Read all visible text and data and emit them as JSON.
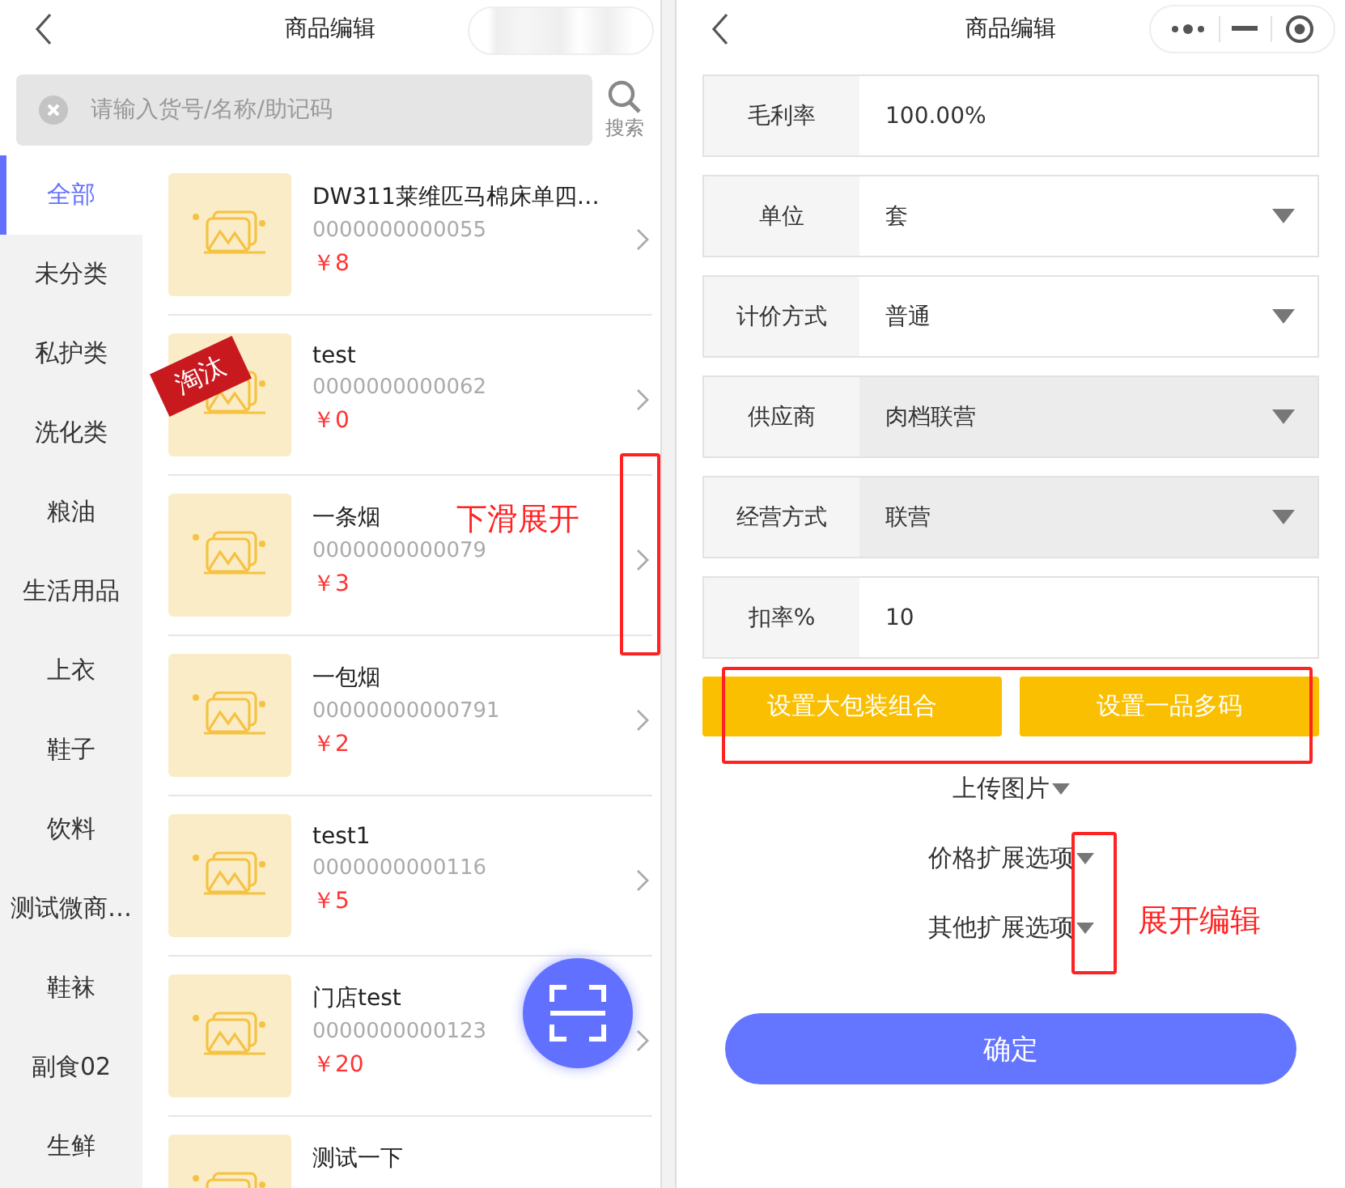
{
  "left": {
    "title": "商品编辑",
    "search": {
      "placeholder": "请输入货号/名称/助记码",
      "button": "搜索"
    },
    "categories": [
      {
        "label": "全部",
        "selected": true
      },
      {
        "label": "未分类",
        "selected": false
      },
      {
        "label": "私护类",
        "selected": false
      },
      {
        "label": "洗化类",
        "selected": false
      },
      {
        "label": "粮油",
        "selected": false
      },
      {
        "label": "生活用品",
        "selected": false
      },
      {
        "label": "上衣",
        "selected": false
      },
      {
        "label": "鞋子",
        "selected": false
      },
      {
        "label": "饮料",
        "selected": false
      },
      {
        "label": "测试微商…",
        "selected": false
      },
      {
        "label": "鞋袜",
        "selected": false
      },
      {
        "label": "副食02",
        "selected": false
      },
      {
        "label": "生鲜",
        "selected": false
      }
    ],
    "products": [
      {
        "name": "DW311莱维匹马棉床单四…",
        "code": "0000000000055",
        "price": "￥8"
      },
      {
        "name": "test",
        "code": "0000000000062",
        "price": "￥0",
        "tag": "淘汰"
      },
      {
        "name": "一条烟",
        "code": "0000000000079",
        "price": "￥3"
      },
      {
        "name": "一包烟",
        "code": "00000000000791",
        "price": "￥2"
      },
      {
        "name": "test1",
        "code": "0000000000116",
        "price": "￥5"
      },
      {
        "name": "门店test",
        "code": "0000000000123",
        "price": "￥20"
      },
      {
        "name": "测试一下"
      }
    ],
    "annotation": "下滑展开"
  },
  "right": {
    "title": "商品编辑",
    "fields": [
      {
        "label": "毛利率",
        "value": "100.00%",
        "kind": "text",
        "disabled": false
      },
      {
        "label": "单位",
        "value": "套",
        "kind": "select",
        "disabled": false
      },
      {
        "label": "计价方式",
        "value": "普通",
        "kind": "select",
        "disabled": false
      },
      {
        "label": "供应商",
        "value": "肉档联营",
        "kind": "select",
        "disabled": true
      },
      {
        "label": "经营方式",
        "value": "联营",
        "kind": "select",
        "disabled": true
      },
      {
        "label": "扣率%",
        "value": "10",
        "kind": "text",
        "disabled": false
      }
    ],
    "buttons": [
      "设置大包装组合",
      "设置一品多码"
    ],
    "expanders": [
      "上传图片",
      "价格扩展选项",
      "其他扩展选项"
    ],
    "confirm": "确定",
    "annotation": "展开编辑"
  }
}
